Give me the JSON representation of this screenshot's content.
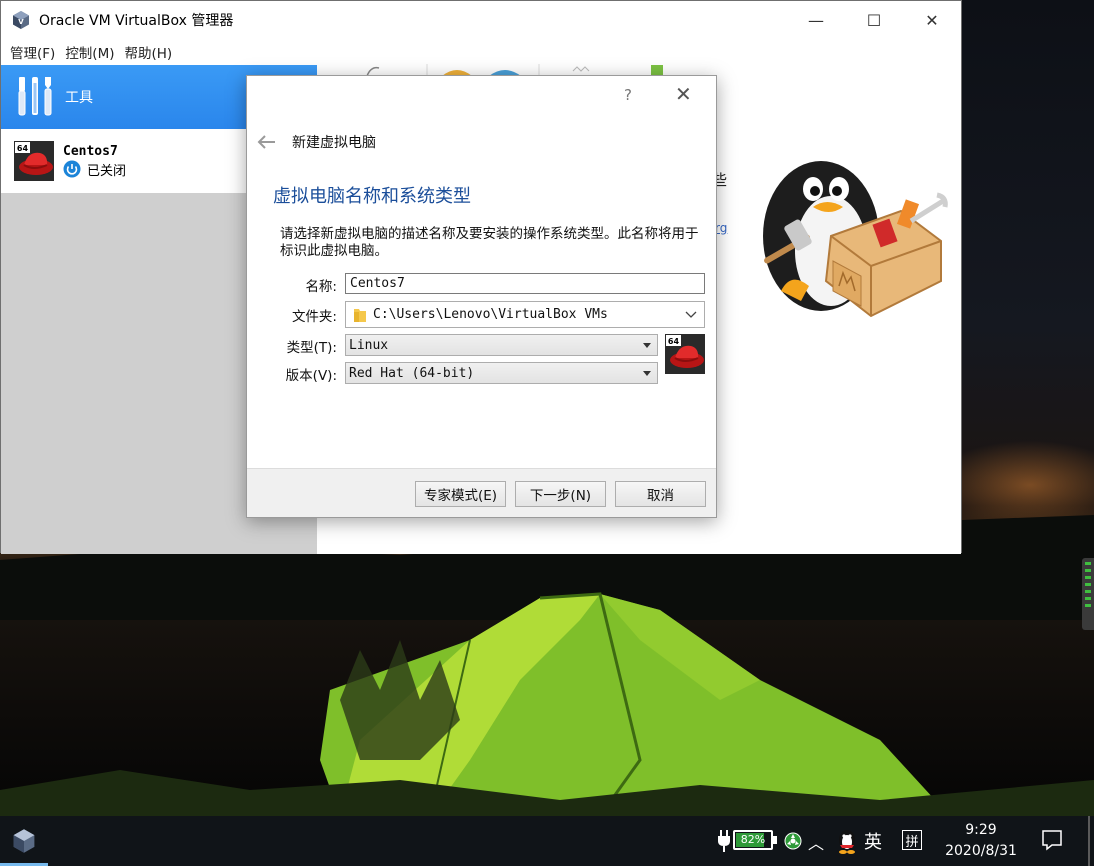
{
  "window": {
    "title": "Oracle VM VirtualBox 管理器",
    "minimize_glyph": "—",
    "maximize_glyph": "☐",
    "close_glyph": "✕"
  },
  "menu": [
    {
      "label": "管理(F)"
    },
    {
      "label": "控制(M)"
    },
    {
      "label": "帮助(H)"
    }
  ],
  "sidebar": {
    "tools_label": "工具",
    "vm": {
      "name": "Centos7",
      "state": "已关闭",
      "os_badge": "64"
    }
  },
  "right_pane": {
    "partial_text": "些",
    "partial_link": "rg"
  },
  "dialog": {
    "help_glyph": "?",
    "close_glyph": "✕",
    "header_title": "新建虚拟电脑",
    "section_title": "虚拟电脑名称和系统类型",
    "description": "请选择新虚拟电脑的描述名称及要安装的操作系统类型。此名称将用于标识此虚拟电脑。",
    "name_label": "名称:",
    "name_value": "Centos7",
    "folder_label": "文件夹:",
    "folder_value": "C:\\Users\\Lenovo\\VirtualBox VMs",
    "type_label": "类型(T):",
    "type_value": "Linux",
    "version_label": "版本(V):",
    "version_value": "Red Hat (64-bit)",
    "os_badge": "64",
    "buttons": {
      "expert": "专家模式(E)",
      "next": "下一步(N)",
      "cancel": "取消"
    }
  },
  "taskbar": {
    "battery_percent": "82%",
    "battery_level": 0.82,
    "chevron": "︿",
    "ime_lang": "英",
    "ime_mode": "拼",
    "time": "9:29",
    "date": "2020/8/31"
  },
  "colors": {
    "selection_blue": "#2a86ec",
    "dialog_title_blue": "#1b4e9a",
    "battery_green": "#2e9a38"
  }
}
